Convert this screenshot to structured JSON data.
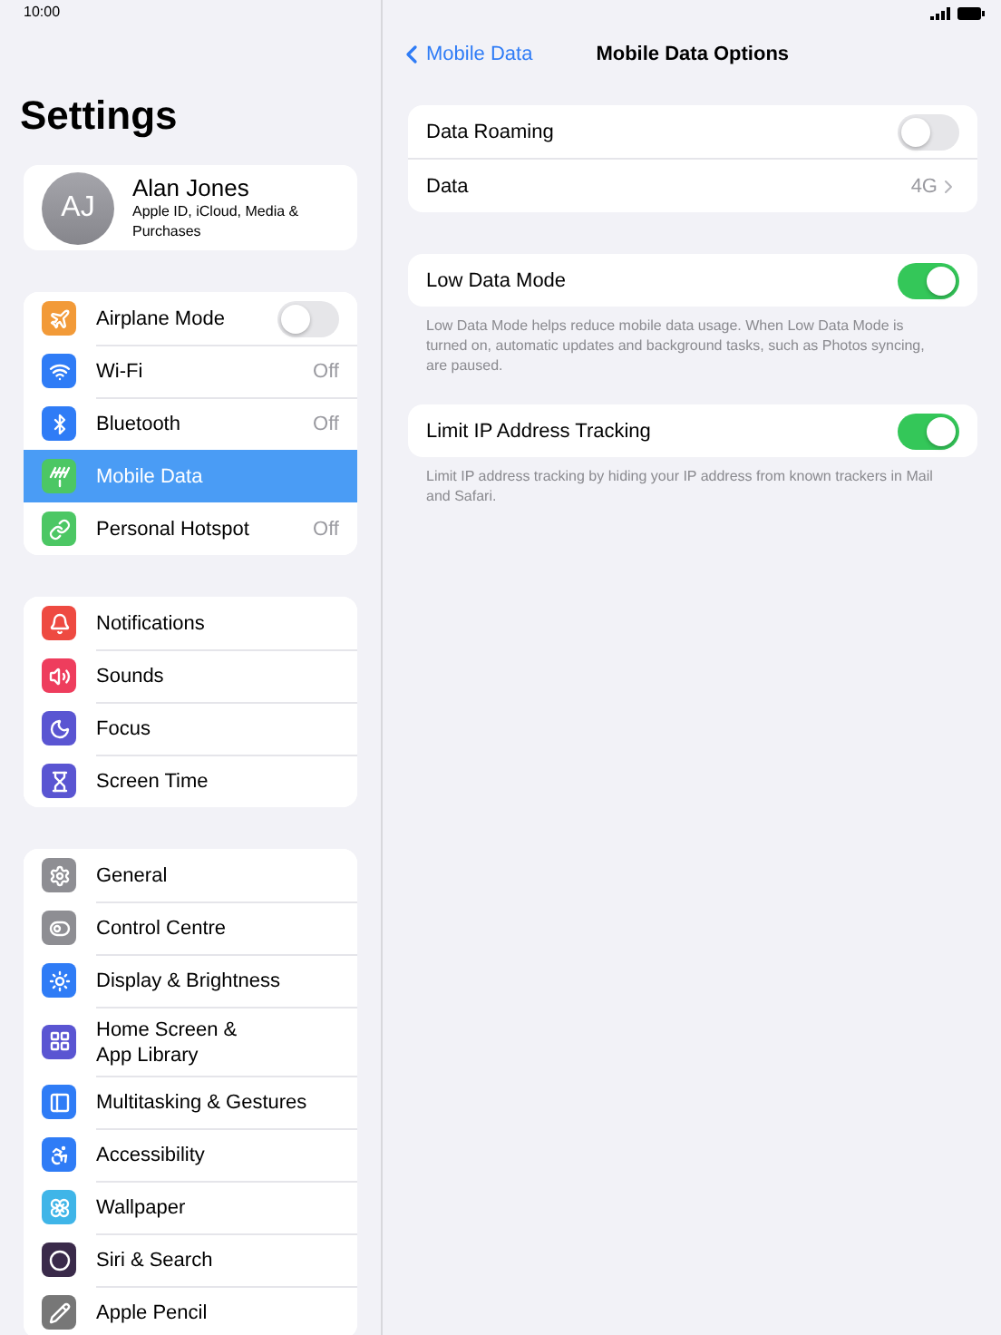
{
  "status_bar": {
    "time": "10:00"
  },
  "sidebar": {
    "title": "Settings",
    "profile": {
      "initials": "AJ",
      "name": "Alan Jones",
      "subtitle": "Apple ID, iCloud, Media & Purchases"
    },
    "groups": [
      [
        {
          "label": "Airplane Mode",
          "kind": "toggle",
          "on": false,
          "selected": false,
          "color": "#f29a38"
        },
        {
          "label": "Wi-Fi",
          "kind": "value",
          "value": "Off",
          "selected": false,
          "color": "#2f7cf6"
        },
        {
          "label": "Bluetooth",
          "kind": "value",
          "value": "Off",
          "selected": false,
          "color": "#2f7cf6"
        },
        {
          "label": "Mobile Data",
          "kind": "plain",
          "selected": true,
          "color": "#4cc764"
        },
        {
          "label": "Personal Hotspot",
          "kind": "value",
          "value": "Off",
          "selected": false,
          "color": "#4cc764"
        }
      ],
      [
        {
          "label": "Notifications",
          "kind": "plain",
          "selected": false,
          "color": "#ee4a41"
        },
        {
          "label": "Sounds",
          "kind": "plain",
          "selected": false,
          "color": "#ee3d5d"
        },
        {
          "label": "Focus",
          "kind": "plain",
          "selected": false,
          "color": "#5a55d2"
        },
        {
          "label": "Screen Time",
          "kind": "plain",
          "selected": false,
          "color": "#5a55d2"
        }
      ],
      [
        {
          "label": "General",
          "kind": "plain",
          "selected": false,
          "color": "#8e8e93"
        },
        {
          "label": "Control Centre",
          "kind": "plain",
          "selected": false,
          "color": "#8e8e93"
        },
        {
          "label": "Display & Brightness",
          "kind": "plain",
          "selected": false,
          "color": "#2f7cf6"
        },
        {
          "label": "Home Screen & App Library",
          "kind": "plain",
          "selected": false,
          "color": "#5a55d2"
        },
        {
          "label": "Multitasking & Gestures",
          "kind": "plain",
          "selected": false,
          "color": "#2f7cf6"
        },
        {
          "label": "Accessibility",
          "kind": "plain",
          "selected": false,
          "color": "#2f7cf6"
        },
        {
          "label": "Wallpaper",
          "kind": "plain",
          "selected": false,
          "color": "#3fb5e8"
        },
        {
          "label": "Siri & Search",
          "kind": "plain",
          "selected": false,
          "color": "#3a2a4a"
        },
        {
          "label": "Apple Pencil",
          "kind": "plain",
          "selected": false,
          "color": "#777777"
        }
      ]
    ]
  },
  "detail": {
    "back": "Mobile Data",
    "title": "Mobile Data Options",
    "sections": [
      {
        "rows": [
          {
            "label": "Data Roaming",
            "kind": "toggle",
            "on": false
          },
          {
            "label": "Data",
            "kind": "value",
            "value": "4G"
          }
        ]
      },
      {
        "rows": [
          {
            "label": "Low Data Mode",
            "kind": "toggle",
            "on": true
          }
        ],
        "footer": "Low Data Mode helps reduce mobile data usage. When Low Data Mode is turned on, automatic updates and background tasks, such as Photos syncing, are paused."
      },
      {
        "rows": [
          {
            "label": "Limit IP Address Tracking",
            "kind": "toggle",
            "on": true
          }
        ],
        "footer": "Limit IP address tracking by hiding your IP address from known trackers in Mail and Safari."
      }
    ]
  }
}
